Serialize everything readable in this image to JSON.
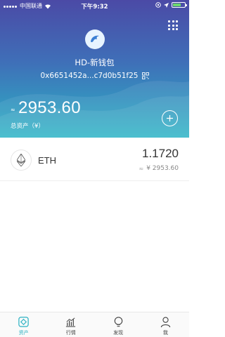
{
  "status_bar": {
    "carrier": "中国联通",
    "time": "下午9:32"
  },
  "wallet": {
    "name": "HD-新钱包",
    "address": "0x6651452a...c7d0b51f25"
  },
  "balance": {
    "approx_symbol": "≈",
    "total": "2953.60",
    "label": "总资产（¥）"
  },
  "assets": [
    {
      "symbol": "ETH",
      "amount": "1.1720",
      "approx": "≈",
      "value": "¥ 2953.60"
    }
  ],
  "tabs": [
    {
      "label": "资产",
      "icon": "assets-icon",
      "active": true
    },
    {
      "label": "行情",
      "icon": "market-chart-icon",
      "active": false
    },
    {
      "label": "发现",
      "icon": "discover-bulb-icon",
      "active": false
    },
    {
      "label": "我",
      "icon": "profile-icon",
      "active": false
    }
  ],
  "colors": {
    "header_top": "#4b4aa6",
    "header_bottom": "#2cb4c6",
    "accent": "#2cb2c3"
  }
}
